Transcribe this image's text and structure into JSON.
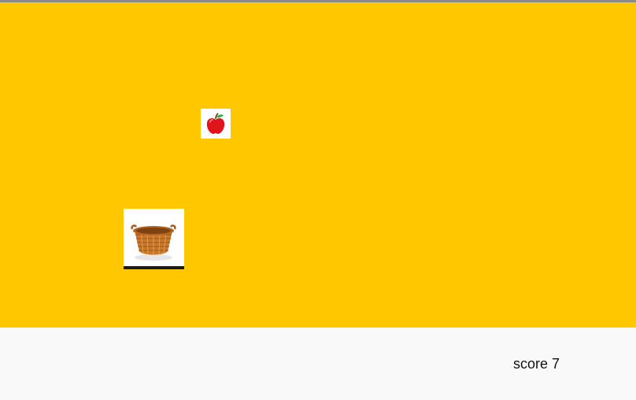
{
  "game": {
    "background_color": "#ffc700",
    "falling_item": {
      "icon": "apple-icon"
    },
    "catcher": {
      "icon": "basket-icon"
    }
  },
  "hud": {
    "score_text": "score 7"
  }
}
